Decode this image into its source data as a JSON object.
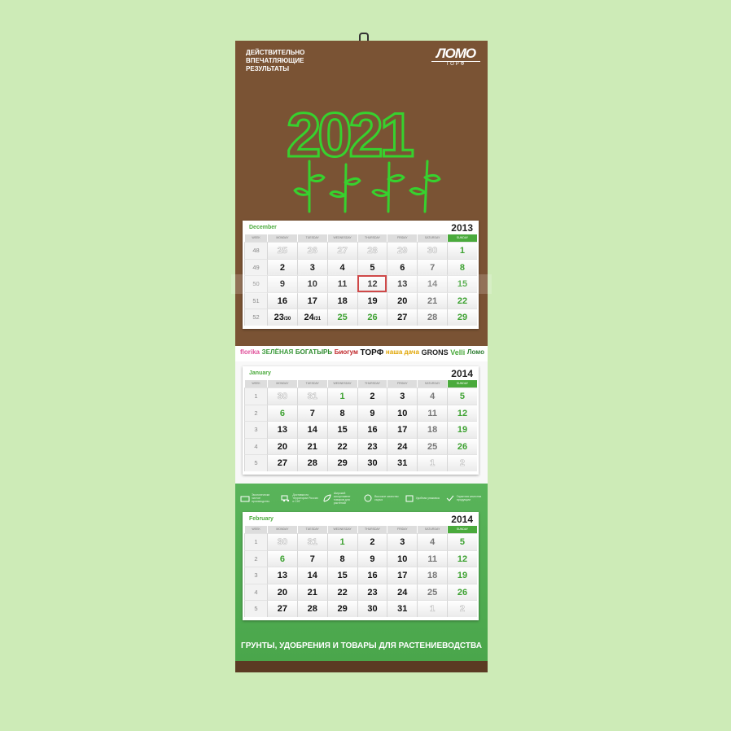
{
  "header": {
    "tagline": [
      "ДЕЙСТВИТЕЛЬНО",
      "ВПЕЧАТЛЯЮЩИЕ",
      "РЕЗУЛЬТАТЫ"
    ],
    "logo_name": "ЛОМО",
    "logo_sub": "ТОРФ",
    "big_year": "2021"
  },
  "brands": [
    "florika",
    "ЗЕЛЁНАЯ",
    "БОГАТЫРЬ",
    "Биогум",
    "ТОРФ",
    "наша дача",
    "GRONS",
    "Velli",
    "Ломо"
  ],
  "features": [
    "Экологически чистое производство",
    "Доставка по территории России и СНГ",
    "Широкий ассортимент товаров для растений",
    "Высокое качество сырья",
    "Удобная упаковка",
    "Гарантия качества продукции"
  ],
  "footer_text": "ГРУНТЫ, УДОБРЕНИЯ И ТОВАРЫ ДЛЯ РАСТЕНИЕВОДСТВА",
  "weekday_headers": [
    "WEEK",
    "MONDAY",
    "TUESDAY",
    "WEDNESDAY",
    "THURSDAY",
    "FRIDAY",
    "SATURDAY",
    "SUNDAY"
  ],
  "calendars": [
    {
      "month": "December",
      "year": "2013",
      "weeks": [
        {
          "wk": "48",
          "days": [
            {
              "d": "25",
              "s": "ghost"
            },
            {
              "d": "26",
              "s": "ghost"
            },
            {
              "d": "27",
              "s": "ghost"
            },
            {
              "d": "28",
              "s": "ghost"
            },
            {
              "d": "29",
              "s": "ghost"
            },
            {
              "d": "30",
              "s": "ghost"
            },
            {
              "d": "1",
              "s": "green"
            }
          ]
        },
        {
          "wk": "49",
          "days": [
            {
              "d": "2"
            },
            {
              "d": "3"
            },
            {
              "d": "4"
            },
            {
              "d": "5"
            },
            {
              "d": "6"
            },
            {
              "d": "7",
              "s": "grey"
            },
            {
              "d": "8",
              "s": "green"
            }
          ]
        },
        {
          "wk": "50",
          "days": [
            {
              "d": "9"
            },
            {
              "d": "10"
            },
            {
              "d": "11"
            },
            {
              "d": "12",
              "s": "today"
            },
            {
              "d": "13"
            },
            {
              "d": "14",
              "s": "grey"
            },
            {
              "d": "15",
              "s": "green"
            }
          ]
        },
        {
          "wk": "51",
          "days": [
            {
              "d": "16"
            },
            {
              "d": "17"
            },
            {
              "d": "18"
            },
            {
              "d": "19"
            },
            {
              "d": "20"
            },
            {
              "d": "21",
              "s": "grey"
            },
            {
              "d": "22",
              "s": "green"
            }
          ]
        },
        {
          "wk": "52",
          "days": [
            {
              "d": "23",
              "alt": "/30"
            },
            {
              "d": "24",
              "alt": "/31"
            },
            {
              "d": "25",
              "s": "green"
            },
            {
              "d": "26",
              "s": "green"
            },
            {
              "d": "27"
            },
            {
              "d": "28",
              "s": "grey"
            },
            {
              "d": "29",
              "s": "green"
            }
          ]
        }
      ]
    },
    {
      "month": "January",
      "year": "2014",
      "weeks": [
        {
          "wk": "1",
          "days": [
            {
              "d": "30",
              "s": "ghost"
            },
            {
              "d": "31",
              "s": "ghost"
            },
            {
              "d": "1",
              "s": "green"
            },
            {
              "d": "2"
            },
            {
              "d": "3"
            },
            {
              "d": "4",
              "s": "grey"
            },
            {
              "d": "5",
              "s": "green"
            }
          ]
        },
        {
          "wk": "2",
          "days": [
            {
              "d": "6",
              "s": "green"
            },
            {
              "d": "7"
            },
            {
              "d": "8"
            },
            {
              "d": "9"
            },
            {
              "d": "10"
            },
            {
              "d": "11",
              "s": "grey"
            },
            {
              "d": "12",
              "s": "green"
            }
          ]
        },
        {
          "wk": "3",
          "days": [
            {
              "d": "13"
            },
            {
              "d": "14"
            },
            {
              "d": "15"
            },
            {
              "d": "16"
            },
            {
              "d": "17"
            },
            {
              "d": "18",
              "s": "grey"
            },
            {
              "d": "19",
              "s": "green"
            }
          ]
        },
        {
          "wk": "4",
          "days": [
            {
              "d": "20"
            },
            {
              "d": "21"
            },
            {
              "d": "22"
            },
            {
              "d": "23"
            },
            {
              "d": "24"
            },
            {
              "d": "25",
              "s": "grey"
            },
            {
              "d": "26",
              "s": "green"
            }
          ]
        },
        {
          "wk": "5",
          "days": [
            {
              "d": "27"
            },
            {
              "d": "28"
            },
            {
              "d": "29"
            },
            {
              "d": "30"
            },
            {
              "d": "31"
            },
            {
              "d": "1",
              "s": "ghost"
            },
            {
              "d": "2",
              "s": "ghost"
            }
          ]
        }
      ]
    },
    {
      "month": "February",
      "year": "2014",
      "weeks": [
        {
          "wk": "1",
          "days": [
            {
              "d": "30",
              "s": "ghost"
            },
            {
              "d": "31",
              "s": "ghost"
            },
            {
              "d": "1",
              "s": "green"
            },
            {
              "d": "2"
            },
            {
              "d": "3"
            },
            {
              "d": "4",
              "s": "grey"
            },
            {
              "d": "5",
              "s": "green"
            }
          ]
        },
        {
          "wk": "2",
          "days": [
            {
              "d": "6",
              "s": "green"
            },
            {
              "d": "7"
            },
            {
              "d": "8"
            },
            {
              "d": "9"
            },
            {
              "d": "10"
            },
            {
              "d": "11",
              "s": "grey"
            },
            {
              "d": "12",
              "s": "green"
            }
          ]
        },
        {
          "wk": "3",
          "days": [
            {
              "d": "13"
            },
            {
              "d": "14"
            },
            {
              "d": "15"
            },
            {
              "d": "16"
            },
            {
              "d": "17"
            },
            {
              "d": "18",
              "s": "grey"
            },
            {
              "d": "19",
              "s": "green"
            }
          ]
        },
        {
          "wk": "4",
          "days": [
            {
              "d": "20"
            },
            {
              "d": "21"
            },
            {
              "d": "22"
            },
            {
              "d": "23"
            },
            {
              "d": "24"
            },
            {
              "d": "25",
              "s": "grey"
            },
            {
              "d": "26",
              "s": "green"
            }
          ]
        },
        {
          "wk": "5",
          "days": [
            {
              "d": "27"
            },
            {
              "d": "28"
            },
            {
              "d": "29"
            },
            {
              "d": "30"
            },
            {
              "d": "31"
            },
            {
              "d": "1",
              "s": "ghost"
            },
            {
              "d": "2",
              "s": "ghost"
            }
          ]
        }
      ]
    }
  ],
  "colors": {
    "background": "#cdebb7",
    "header_brown": "#7a5334",
    "accent_green": "#4aaa3c",
    "band_green": "#59b45a",
    "today_outline": "#c52222"
  }
}
